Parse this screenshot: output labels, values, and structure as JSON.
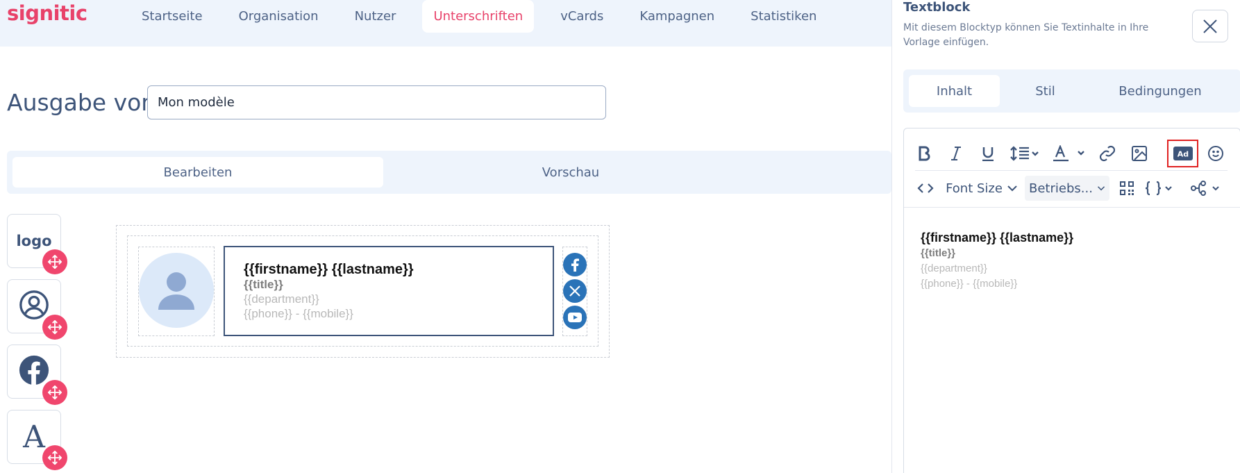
{
  "brand": {
    "logo_text": "signitic",
    "accent": "#e8426a"
  },
  "nav": {
    "items": [
      "Startseite",
      "Organisation",
      "Nutzer",
      "Unterschriften",
      "vCards",
      "Kampagnen",
      "Statistiken"
    ],
    "active": "Unterschriften"
  },
  "editor_page": {
    "title": "Ausgabe von",
    "template_name": "Mon modèle",
    "tabs": [
      "Bearbeiten",
      "Vorschau"
    ],
    "active_tab": "Bearbeiten"
  },
  "palette": {
    "blocks": [
      {
        "label": "logo",
        "icon": "logo-text"
      },
      {
        "icon": "user-circle-icon"
      },
      {
        "icon": "facebook-icon"
      },
      {
        "label": "A",
        "icon": "text-icon"
      }
    ],
    "move_icon": "move-icon"
  },
  "signature": {
    "name": "{{firstname}} {{lastname}}",
    "title": "{{title}}",
    "department": "{{department}}",
    "phone_line": "{{phone}} - {{mobile}}",
    "socials": [
      "facebook-icon",
      "x-icon",
      "youtube-icon"
    ],
    "social_color": "#2a73b8"
  },
  "panel": {
    "title": "Textblock",
    "description": "Mit diesem Blocktyp können Sie Textinhalte in Ihre Vorlage einfügen.",
    "tabs": [
      "Inhalt",
      "Stil",
      "Bedingungen"
    ],
    "active_tab": "Inhalt",
    "toolbar": {
      "font_size_label": "Font Size",
      "font_family_value": "Betriebs...",
      "ad_label": "Ad"
    },
    "content": {
      "name": "{{firstname}} {{lastname}}",
      "title": "{{title}}",
      "department": "{{department}}",
      "phone_line": "{{phone}} - {{mobile}}"
    }
  }
}
